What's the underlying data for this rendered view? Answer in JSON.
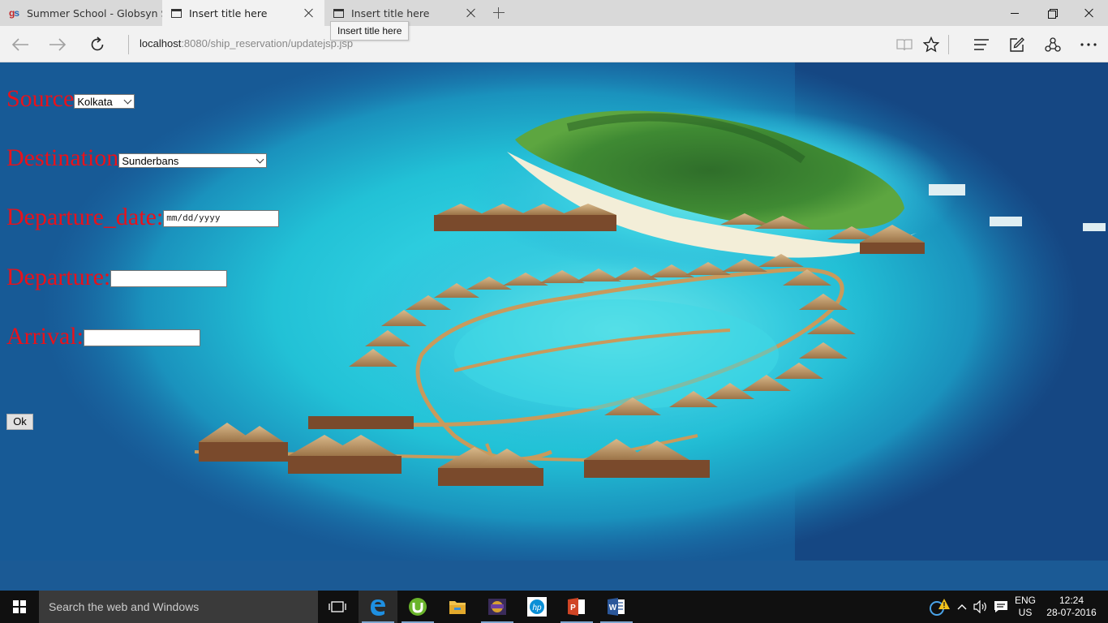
{
  "browser": {
    "tabs": [
      {
        "title": "Summer School - Globsyn SI",
        "favicon": "gs-logo",
        "state": "inactive"
      },
      {
        "title": "Insert title here",
        "favicon": "page-icon",
        "state": "active"
      },
      {
        "title": "Insert title here",
        "favicon": "page-icon",
        "state": "inactive"
      }
    ],
    "tooltip": "Insert title here",
    "address": {
      "host": "localhost",
      "path": ":8080/ship_reservation/updatejsp.jsp"
    },
    "icons": {
      "back": "back-arrow-icon",
      "forward": "forward-arrow-icon",
      "refresh": "refresh-icon",
      "reading_view": "reading-view-icon",
      "favorite": "star-icon",
      "hub": "hub-icon",
      "web_note": "web-note-icon",
      "share": "share-icon",
      "more": "more-icon"
    }
  },
  "form": {
    "source": {
      "label": "Source",
      "value": "Kolkata"
    },
    "destination": {
      "label": "Destination",
      "value": "Sunderbans"
    },
    "departure_date": {
      "label": "Departure_date:",
      "placeholder": "mm/dd/yyyy"
    },
    "departure": {
      "label": "Departure:",
      "value": ""
    },
    "arrival": {
      "label": "Arrival:",
      "value": ""
    },
    "ok_label": "Ok"
  },
  "colors": {
    "label_red": "#e8121b",
    "ocean_deep": "#134d86",
    "lagoon": "#2fd0e0"
  },
  "taskbar": {
    "search_placeholder": "Search the web and Windows",
    "language": "ENG",
    "region": "US",
    "time": "12:24",
    "date": "28-07-2016",
    "pinned": [
      "task-view-icon",
      "edge-icon",
      "utorrent-icon",
      "file-explorer-icon",
      "game-icon",
      "hp-icon",
      "powerpoint-icon",
      "word-icon"
    ]
  }
}
